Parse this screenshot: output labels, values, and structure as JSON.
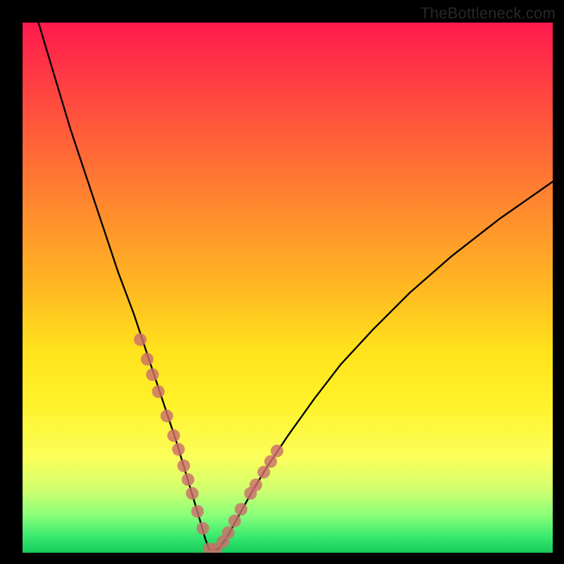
{
  "watermark": "TheBottleneck.com",
  "chart_data": {
    "type": "line",
    "title": "",
    "xlabel": "",
    "ylabel": "",
    "xlim": [
      0,
      100
    ],
    "ylim": [
      0,
      100
    ],
    "grid": false,
    "legend": false,
    "series": [
      {
        "name": "bottleneck-curve",
        "x": [
          3,
          6,
          9,
          12,
          15,
          18,
          21,
          23,
          25,
          27,
          29,
          30.5,
          32,
          33.5,
          34.5,
          35.2,
          36.8,
          38.5,
          40.5,
          43,
          46,
          50,
          55,
          60,
          66,
          73,
          81,
          90,
          100
        ],
        "y": [
          100,
          90,
          80,
          71,
          62,
          53,
          45,
          39,
          33,
          27,
          21,
          16,
          11,
          6,
          2.5,
          0.6,
          0.6,
          2.8,
          6.5,
          11,
          16,
          22,
          29,
          35.5,
          42,
          49,
          56,
          63,
          70
        ],
        "color": "#000000"
      },
      {
        "name": "highlight-dots",
        "x": [
          22.2,
          23.5,
          24.5,
          25.6,
          27.2,
          28.5,
          29.4,
          30.4,
          31.2,
          32.0,
          33.0,
          34.0,
          35.2,
          36.5,
          37.8,
          38.8,
          40.0,
          41.2,
          43.0,
          44.0,
          45.5,
          46.8,
          48.0
        ],
        "y": [
          40.2,
          36.5,
          33.6,
          30.4,
          25.8,
          22.1,
          19.5,
          16.4,
          13.8,
          11.2,
          7.8,
          4.6,
          0.7,
          0.7,
          2.1,
          3.8,
          6.0,
          8.2,
          11.2,
          12.8,
          15.2,
          17.2,
          19.2
        ],
        "color": "#cb6f6b"
      }
    ],
    "annotations": []
  },
  "colors": {
    "curve": "#000000",
    "dots": "#cb6f6b",
    "frame": "#000000"
  }
}
